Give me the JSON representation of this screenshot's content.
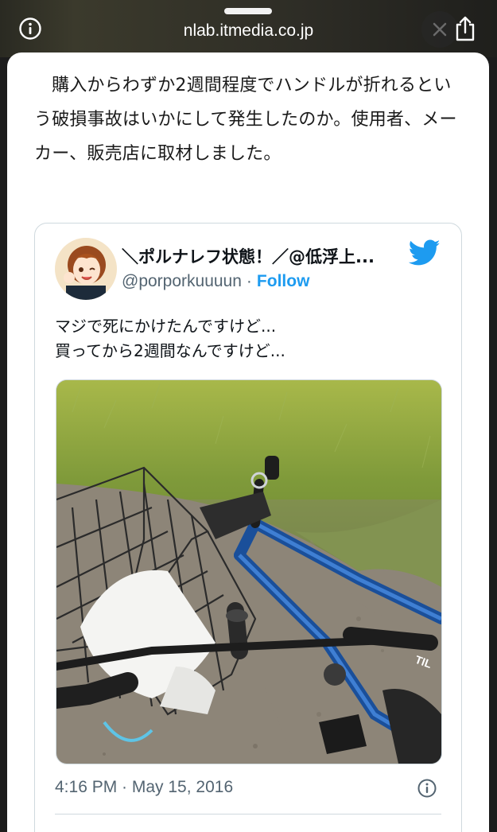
{
  "browser": {
    "url": "nlab.itmedia.co.jp",
    "info_icon": "info-circle-icon",
    "share_icon": "share-icon",
    "close_icon": "close-icon"
  },
  "article": {
    "paragraph": "購入からわずか2週間程度でハンドルが折れるという破損事故はいかにして発生したのか。使用者、メーカー、販売店に取材しました。"
  },
  "tweet": {
    "display_name": "＼ポルナレフ状態！／@低浮上...",
    "handle": "@porporkuuuun",
    "separator": "·",
    "follow_label": "Follow",
    "text_line1": "マジで死にかけたんですけど...",
    "text_line2": "買ってから2週間なんですけど...",
    "timestamp": "4:16 PM · May 15, 2016",
    "logo_icon": "twitter-bird-icon",
    "info_icon": "info-circle-icon",
    "accent_color": "#1d9bf0"
  }
}
